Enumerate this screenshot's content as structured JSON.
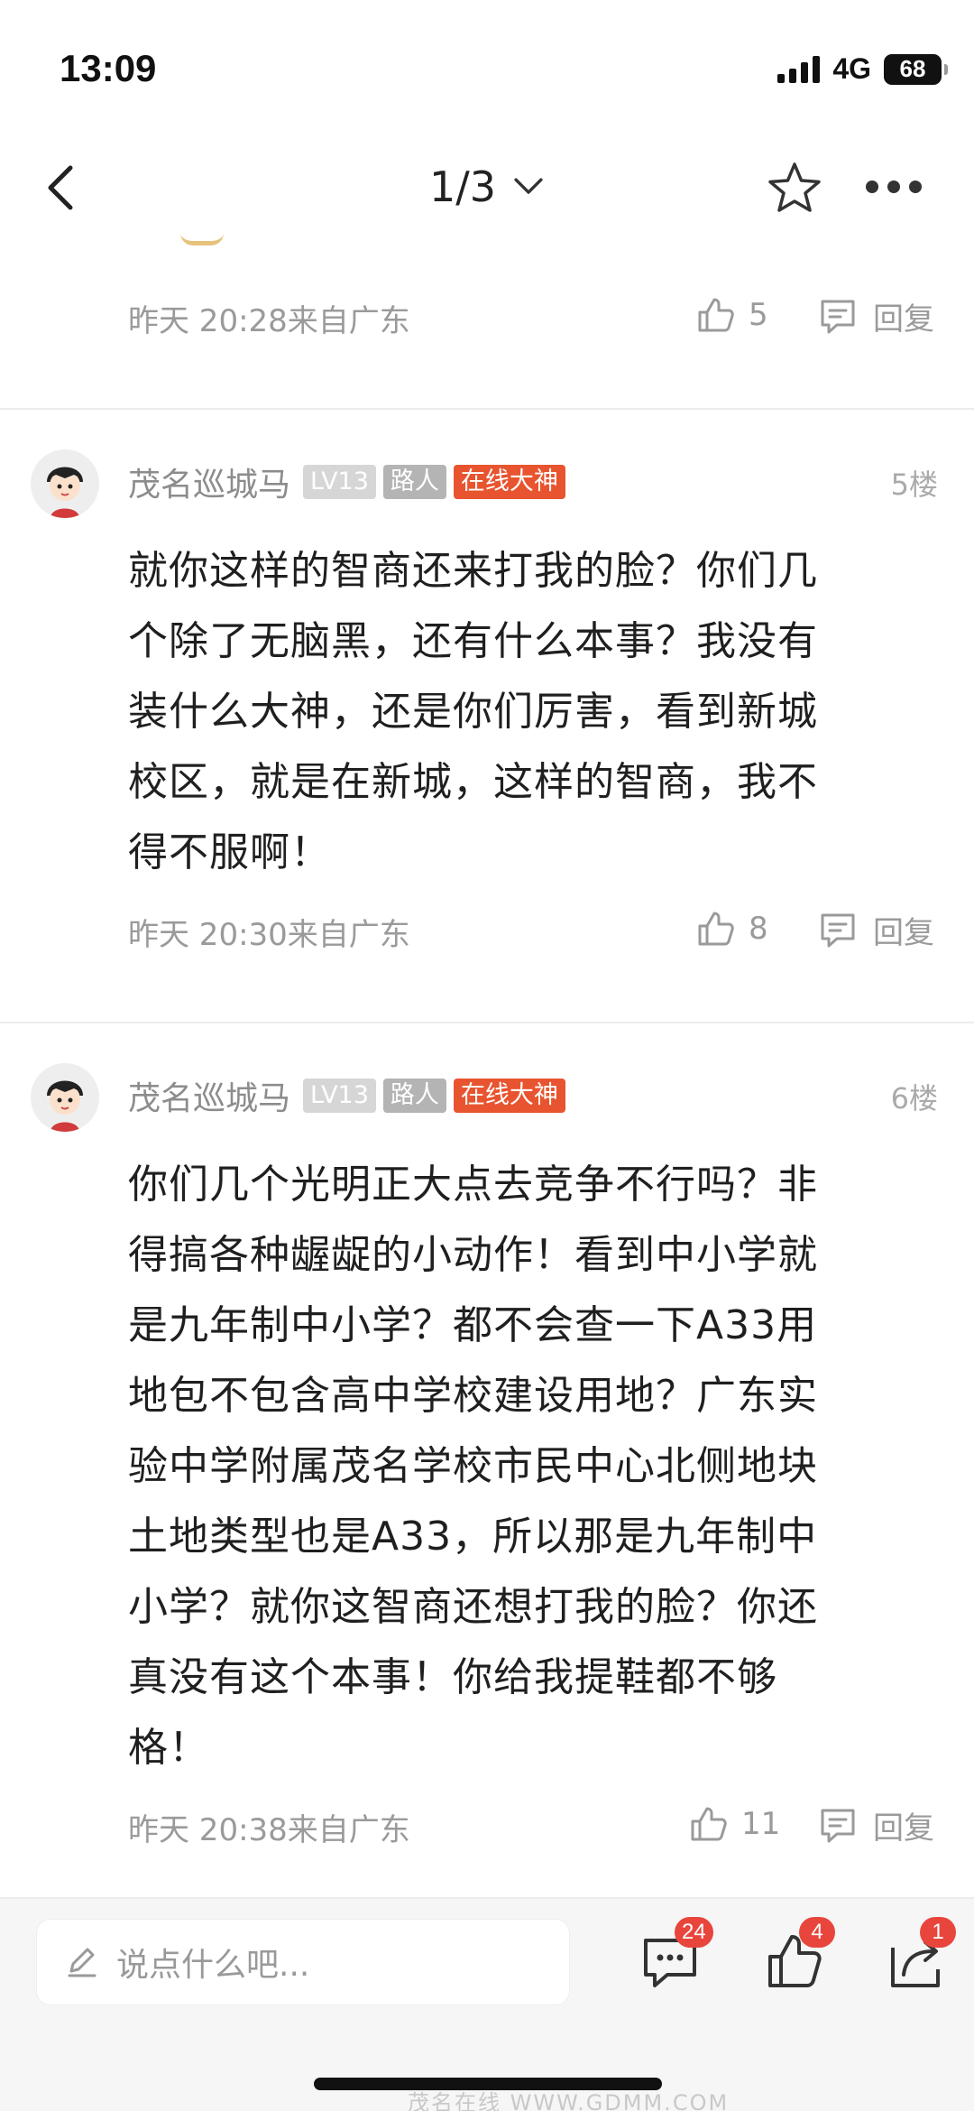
{
  "status_bar": {
    "time": "13:09",
    "network": "4G",
    "battery": "68"
  },
  "nav": {
    "page_indicator": "1/3"
  },
  "prev_post": {
    "time": "昨天 20:28来自广东",
    "likes": "5",
    "reply_label": "回复"
  },
  "posts": [
    {
      "username": "茂名巡城马",
      "level_badge": "LV13",
      "role_badge": "路人",
      "title_badge": "在线大神",
      "floor": "5楼",
      "lines": [
        "就你这样的智商还来打我的脸？你们几",
        "个除了无脑黑，还有什么本事？我没有",
        "装什么大神，还是你们厉害，看到新城",
        "校区，就是在新城，这样的智商，我不",
        "得不服啊！"
      ],
      "time": "昨天 20:30来自广东",
      "likes": "8",
      "reply_label": "回复"
    },
    {
      "username": "茂名巡城马",
      "level_badge": "LV13",
      "role_badge": "路人",
      "title_badge": "在线大神",
      "floor": "6楼",
      "lines": [
        "你们几个光明正大点去竞争不行吗？非",
        "得搞各种龌龊的小动作！看到中小学就",
        "是九年制中小学？都不会查一下A33用",
        "地包不包含高中学校建设用地？广东实",
        "验中学附属茂名学校市民中心北侧地块",
        "土地类型也是A33，所以那是九年制中",
        "小学？就你这智商还想打我的脸？你还",
        "真没有这个本事！你给我提鞋都不够",
        "格！"
      ],
      "time": "昨天 20:38来自广东",
      "likes": "11",
      "reply_label": "回复"
    }
  ],
  "bottom_bar": {
    "input_placeholder": "说点什么吧...",
    "comment_count": "24",
    "like_count": "4",
    "share_count": "1"
  },
  "watermark": "茂名在线 WWW.GDMM.COM",
  "colors": {
    "accent": "#e8542f",
    "badge_red": "#e8453c",
    "muted_text": "#9a9a9a"
  }
}
